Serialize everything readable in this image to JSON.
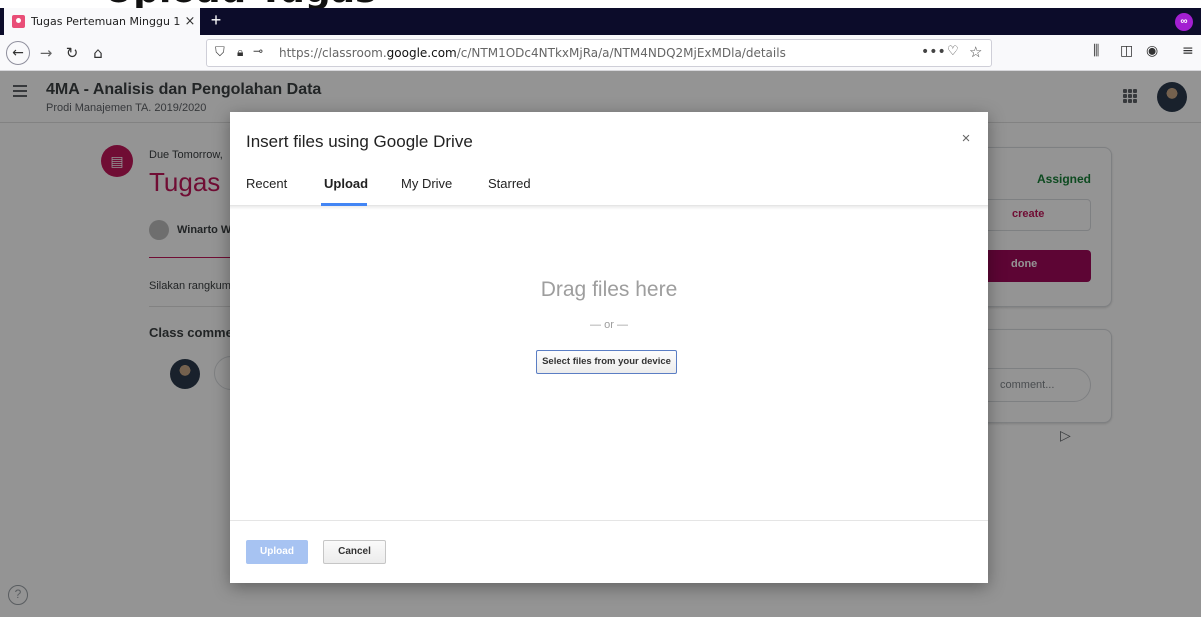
{
  "caption": {
    "text": "Upload Tugas"
  },
  "browser": {
    "tab_title": "Tugas Pertemuan Minggu 1",
    "tab_close": "×",
    "new_tab": "+",
    "url_prefix": "https://classroom.",
    "url_domain": "google.com",
    "url_path": "/c/NTM1ODc4NTkxMjRa/a/NTM4NDQ2MjExMDla/details",
    "page_actions": "•••"
  },
  "classroom": {
    "course_title": "4MA - Analisis dan Pengolahan Data",
    "course_subtitle": "Prodi Manajemen TA. 2019/2020",
    "due": "Due Tomorrow,",
    "assignment_title": "Tugas",
    "author": "Winarto W",
    "description": "Silakan rangkum",
    "class_comments": "Class comme",
    "status": "Assigned",
    "create_label": "create",
    "done_label": "done",
    "private_comment_placeholder": "comment..."
  },
  "dialog": {
    "title": "Insert files using Google Drive",
    "close": "×",
    "tabs": [
      {
        "label": "Recent"
      },
      {
        "label": "Upload"
      },
      {
        "label": "My Drive"
      },
      {
        "label": "Starred"
      }
    ],
    "drag_text": "Drag files here",
    "or_text": "— or —",
    "select_button": "Select files from your device",
    "upload_button": "Upload",
    "cancel_button": "Cancel"
  },
  "colors": {
    "accent_pink": "#c2185b",
    "assigned_green": "#188038",
    "tab_active_blue": "#4285f4",
    "upload_disabled": "#a7c3f2"
  }
}
